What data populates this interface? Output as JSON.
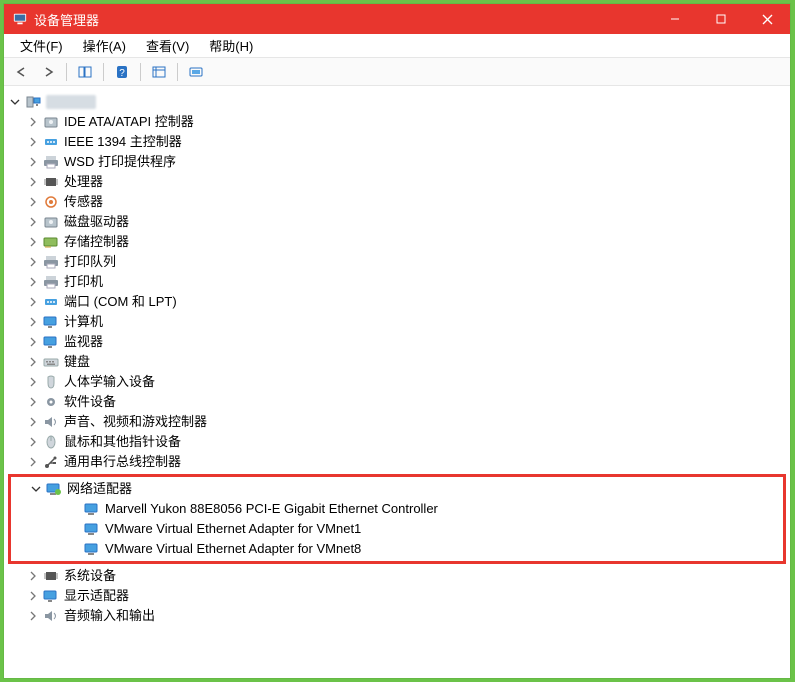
{
  "window": {
    "title": "设备管理器"
  },
  "menu": {
    "file": "文件(F)",
    "action": "操作(A)",
    "view": "查看(V)",
    "help": "帮助(H)"
  },
  "tree": {
    "root": "",
    "categories": [
      {
        "label": "IDE ATA/ATAPI 控制器",
        "expanded": false
      },
      {
        "label": "IEEE 1394 主控制器",
        "expanded": false
      },
      {
        "label": "WSD 打印提供程序",
        "expanded": false
      },
      {
        "label": "处理器",
        "expanded": false
      },
      {
        "label": "传感器",
        "expanded": false
      },
      {
        "label": "磁盘驱动器",
        "expanded": false
      },
      {
        "label": "存储控制器",
        "expanded": false
      },
      {
        "label": "打印队列",
        "expanded": false
      },
      {
        "label": "打印机",
        "expanded": false
      },
      {
        "label": "端口 (COM 和 LPT)",
        "expanded": false
      },
      {
        "label": "计算机",
        "expanded": false
      },
      {
        "label": "监视器",
        "expanded": false
      },
      {
        "label": "键盘",
        "expanded": false
      },
      {
        "label": "人体学输入设备",
        "expanded": false
      },
      {
        "label": "软件设备",
        "expanded": false
      },
      {
        "label": "声音、视频和游戏控制器",
        "expanded": false
      },
      {
        "label": "鼠标和其他指针设备",
        "expanded": false
      },
      {
        "label": "通用串行总线控制器",
        "expanded": false
      },
      {
        "label": "网络适配器",
        "expanded": true,
        "highlight": true,
        "children": [
          "Marvell Yukon 88E8056 PCI-E Gigabit Ethernet Controller",
          "VMware Virtual Ethernet Adapter for VMnet1",
          "VMware Virtual Ethernet Adapter for VMnet8"
        ]
      },
      {
        "label": "系统设备",
        "expanded": false
      },
      {
        "label": "显示适配器",
        "expanded": false
      },
      {
        "label": "音频输入和输出",
        "expanded": false
      }
    ]
  }
}
